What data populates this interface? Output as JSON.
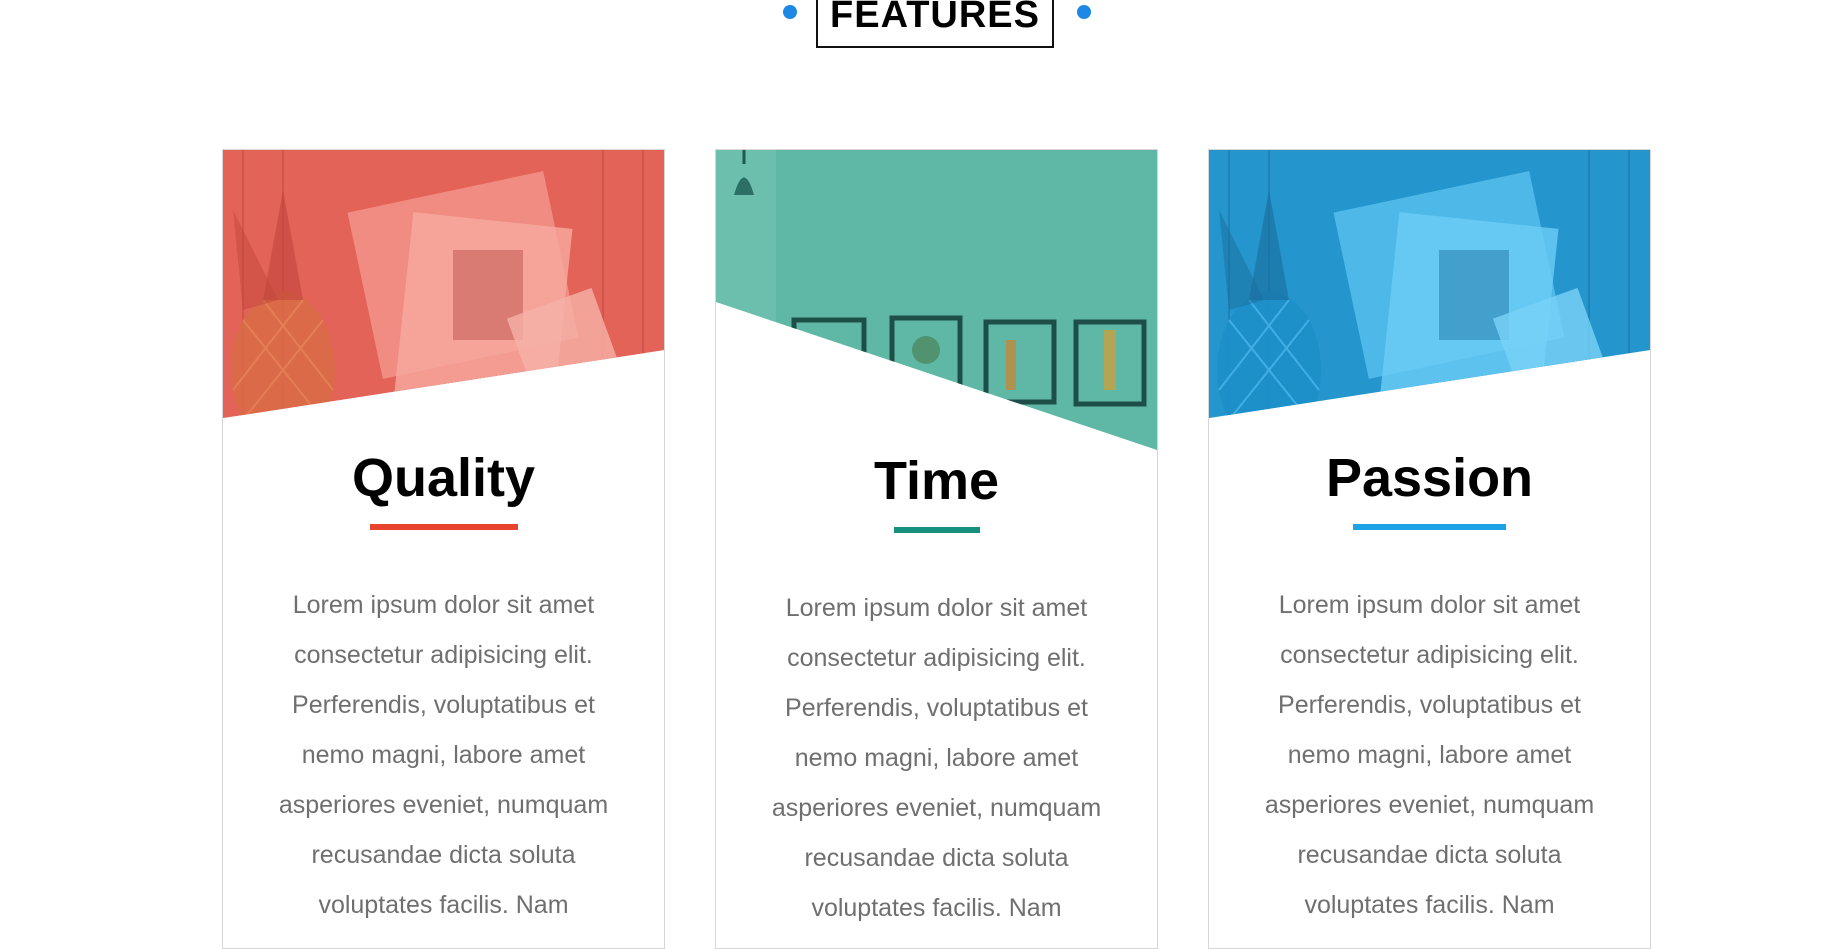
{
  "section": {
    "title": "FEATURES",
    "dot_color": "#1e88e5"
  },
  "cards": [
    {
      "title": "Quality",
      "accent": "#e8432f",
      "overlay": "#ef6a5e",
      "text": "Lorem ipsum dolor sit amet consectetur adipisicing elit. Perferendis, voluptatibus et nemo magni, labore amet asperiores eveniet, numquam recusandae dicta soluta voluptates facilis. Nam"
    },
    {
      "title": "Time",
      "accent": "#16907e",
      "overlay": "#5fb8a6",
      "text": "Lorem ipsum dolor sit amet consectetur adipisicing elit. Perferendis, voluptatibus et nemo magni, labore amet asperiores eveniet, numquam recusandae dicta soluta voluptates facilis. Nam"
    },
    {
      "title": "Passion",
      "accent": "#1ea2e6",
      "overlay": "#2aa3dd",
      "text": "Lorem ipsum dolor sit amet consectetur adipisicing elit. Perferendis, voluptatibus et nemo magni, labore amet asperiores eveniet, numquam recusandae dicta soluta voluptates facilis. Nam"
    }
  ]
}
